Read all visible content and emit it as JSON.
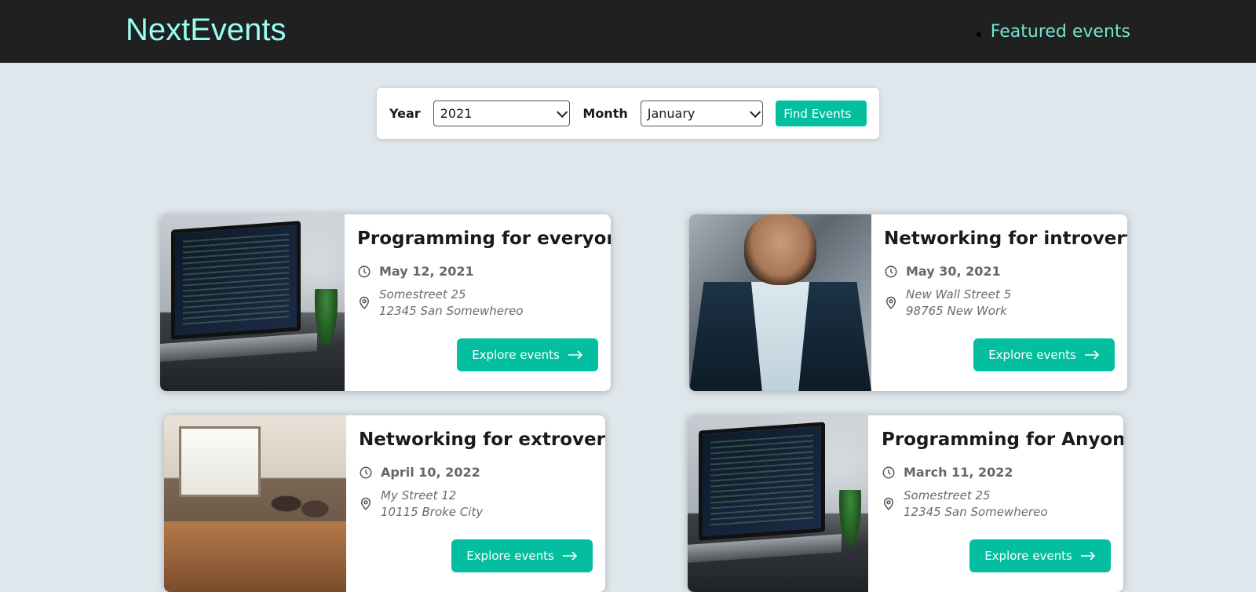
{
  "app": {
    "logo": "NextEvents",
    "nav": [
      {
        "label": "Featured events"
      }
    ]
  },
  "filter": {
    "year_label": "Year",
    "year_value": "2021",
    "month_label": "Month",
    "month_value": "January",
    "find_label": "Find Events"
  },
  "events": [
    {
      "title": "Programming for everyone",
      "date": "May 12, 2021",
      "address_line1": "Somestreet 25",
      "address_line2": "12345 San Somewhereo",
      "button": "Explore events",
      "image": "laptop-code-photo"
    },
    {
      "title": "Networking for introverts",
      "date": "May 30, 2021",
      "address_line1": "New Wall Street 5",
      "address_line2": "98765 New Work",
      "button": "Explore events",
      "image": "man-in-suit-photo"
    },
    {
      "title": "Networking for extroverts",
      "date": "April 10, 2022",
      "address_line1": "My Street 12",
      "address_line2": "10115 Broke City",
      "button": "Explore events",
      "image": "office-meeting-photo"
    },
    {
      "title": "Programming for Anyone",
      "date": "March 11, 2022",
      "address_line1": "Somestreet 25",
      "address_line2": "12345 San Somewhereo",
      "button": "Explore events",
      "image": "laptop-code-photo"
    }
  ],
  "colors": {
    "header_bg": "#202020",
    "logo": "#96fff0",
    "nav_link": "#76e2cf",
    "accent": "#03be9f",
    "page_bg": "#dfe7ec"
  }
}
